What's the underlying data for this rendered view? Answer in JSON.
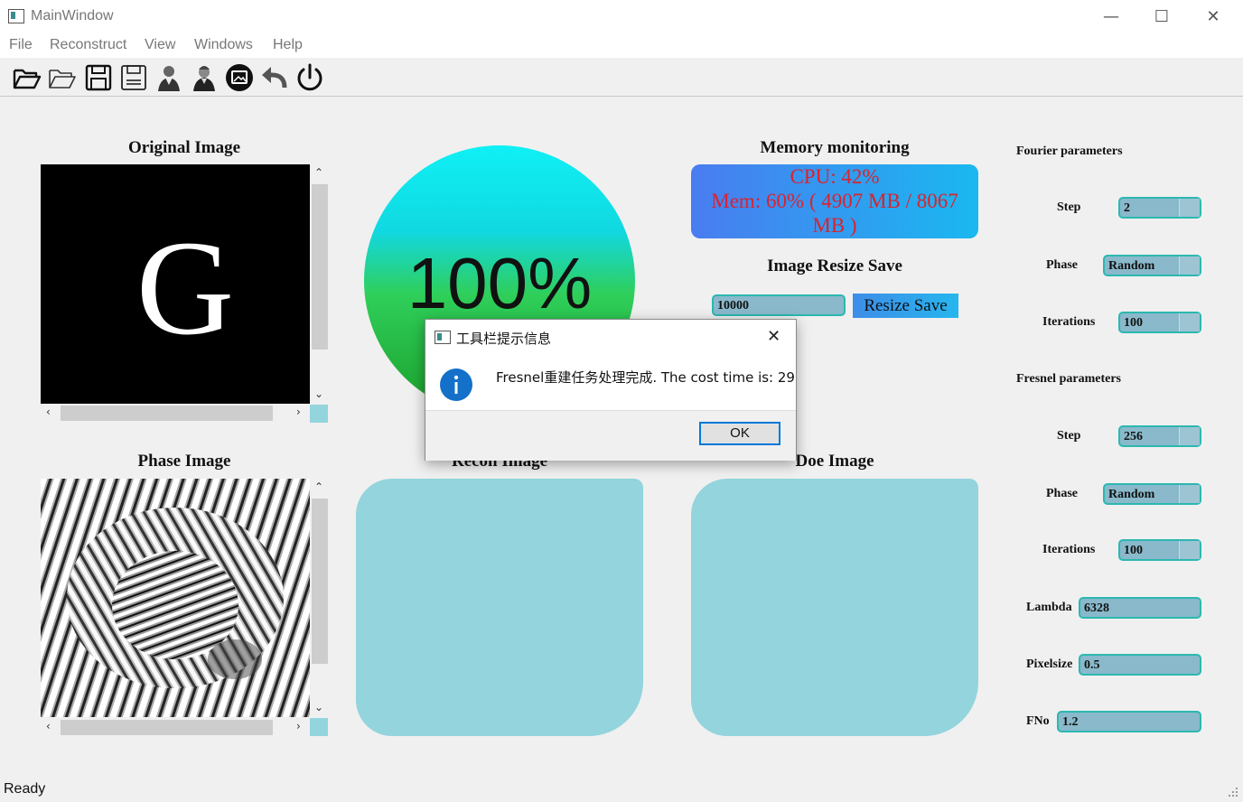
{
  "window": {
    "title": "MainWindow",
    "minimize": "—",
    "maximize": "☐",
    "close": "✕"
  },
  "menu": [
    "File",
    "Reconstruct",
    "View",
    "Windows",
    "Help"
  ],
  "toolbar": [
    "open-file",
    "open-folder",
    "save",
    "save-as",
    "fourier-portrait",
    "fresnel-portrait",
    "view-image",
    "undo",
    "power"
  ],
  "original": {
    "title": "Original Image",
    "glyph": "G"
  },
  "phase": {
    "title": "Phase Image"
  },
  "progress": {
    "value_text": "100%",
    "value": 1.0
  },
  "memory": {
    "title": "Memory monitoring",
    "cpu": "CPU: 42%",
    "mem": "Mem: 60% ( 4907 MB / 8067 MB )"
  },
  "resize": {
    "title": "Image Resize Save",
    "value": "10000",
    "button": "Resize Save"
  },
  "recon": {
    "title": "Recon Image"
  },
  "doe": {
    "title": "Doe Image"
  },
  "fourier": {
    "title": "Fourier parameters",
    "step_label": "Step",
    "step": "2",
    "phase_label": "Phase",
    "phase": "Random",
    "iter_label": "Iterations",
    "iter": "100"
  },
  "fresnel": {
    "title": "Fresnel parameters",
    "step_label": "Step",
    "step": "256",
    "phase_label": "Phase",
    "phase": "Random",
    "iter_label": "Iterations",
    "iter": "100",
    "lambda_label": "Lambda",
    "lambda": "6328",
    "pixelsize_label": "Pixelsize",
    "pixelsize": "0.5",
    "fno_label": "FNo",
    "fno": "1.2"
  },
  "dialog": {
    "title": "工具栏提示信息",
    "message": "Fresnel重建任务处理完成. The cost time is: 29",
    "ok": "OK",
    "close": "✕"
  },
  "status": "Ready",
  "colors": {
    "accent": "#2bb8b0",
    "field": "#89b9cb",
    "image_box": "#93d4dd",
    "error_text": "#d9232e"
  }
}
